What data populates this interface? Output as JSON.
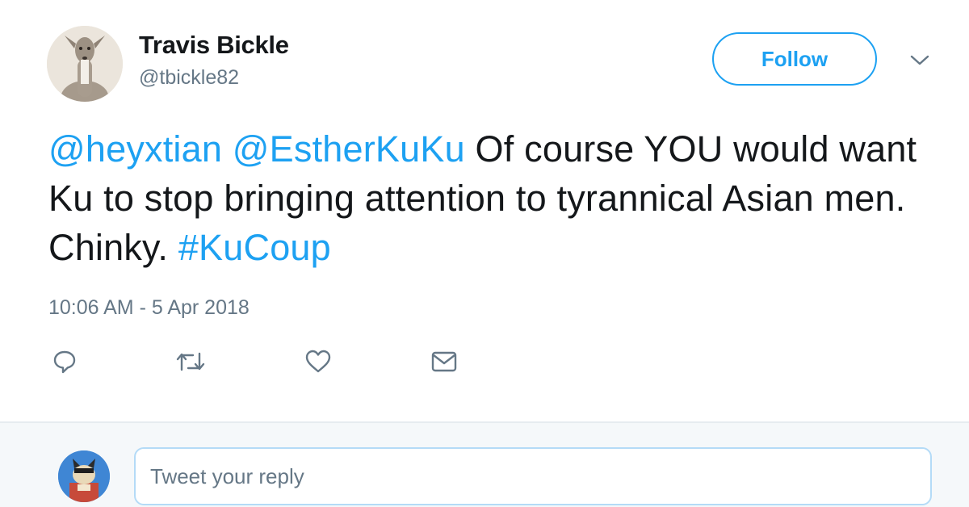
{
  "user": {
    "name": "Travis Bickle",
    "handle": "@tbickle82"
  },
  "follow_button": {
    "label": "Follow"
  },
  "tweet": {
    "segments": [
      {
        "text": "@heyxtian",
        "link": true
      },
      {
        "text": " ",
        "link": false
      },
      {
        "text": "@EstherKuKu",
        "link": true
      },
      {
        "text": " Of course YOU would want Ku to stop bringing attention to tyrannical Asian men. Chinky. ",
        "link": false
      },
      {
        "text": "#KuCoup",
        "link": true
      }
    ],
    "timestamp": "10:06 AM - 5 Apr 2018"
  },
  "actions": {
    "icons": [
      "reply-icon",
      "retweet-icon",
      "like-icon",
      "direct-message-icon"
    ]
  },
  "reply": {
    "placeholder": "Tweet your reply"
  },
  "colors": {
    "accent": "#1da1f2",
    "text": "#14171a",
    "muted": "#657786",
    "reply_bg": "#f5f8fa"
  }
}
